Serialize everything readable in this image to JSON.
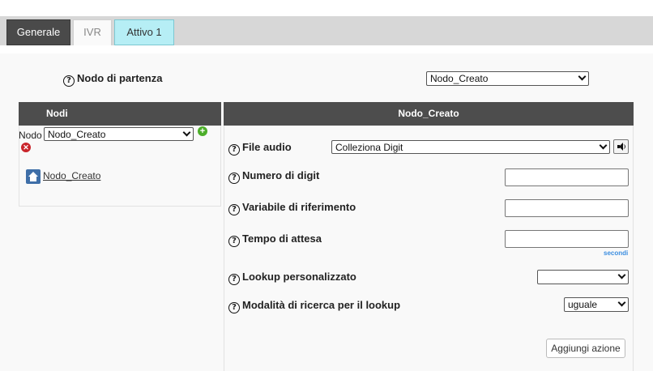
{
  "tabs": [
    {
      "label": "Generale"
    },
    {
      "label": "IVR"
    },
    {
      "label": "Attivo 1"
    }
  ],
  "start_node": {
    "label": "Nodo di partenza",
    "selected": "Nodo_Creato"
  },
  "nodi_panel": {
    "title": "Nodi",
    "nodo_label": "Nodo",
    "nodo_selected": "Nodo_Creato",
    "node_link": "Nodo_Creato"
  },
  "node_panel": {
    "title": "Nodo_Creato",
    "file_audio": {
      "label": "File audio",
      "selected": "Colleziona Digit"
    },
    "numero_digit": {
      "label": "Numero di digit",
      "value": ""
    },
    "variabile": {
      "label": "Variabile di riferimento",
      "value": ""
    },
    "tempo": {
      "label": "Tempo di attesa",
      "value": "",
      "unit": "secondi"
    },
    "lookup": {
      "label": "Lookup personalizzato",
      "selected": ""
    },
    "modalita": {
      "label": "Modalità di ricerca per il lookup",
      "selected": "uguale"
    },
    "add_action": "Aggiungi azione"
  },
  "icons": {
    "help": "question-circle-icon",
    "add": "plus-circle-icon",
    "delete": "x-circle-icon",
    "home": "home-icon",
    "speaker": "speaker-icon"
  },
  "colors": {
    "active_tab": "#b6eef5",
    "header": "#4d4d4d",
    "add": "#4cae2a",
    "delete": "#c9252b",
    "secondi": "#3a8de0"
  }
}
